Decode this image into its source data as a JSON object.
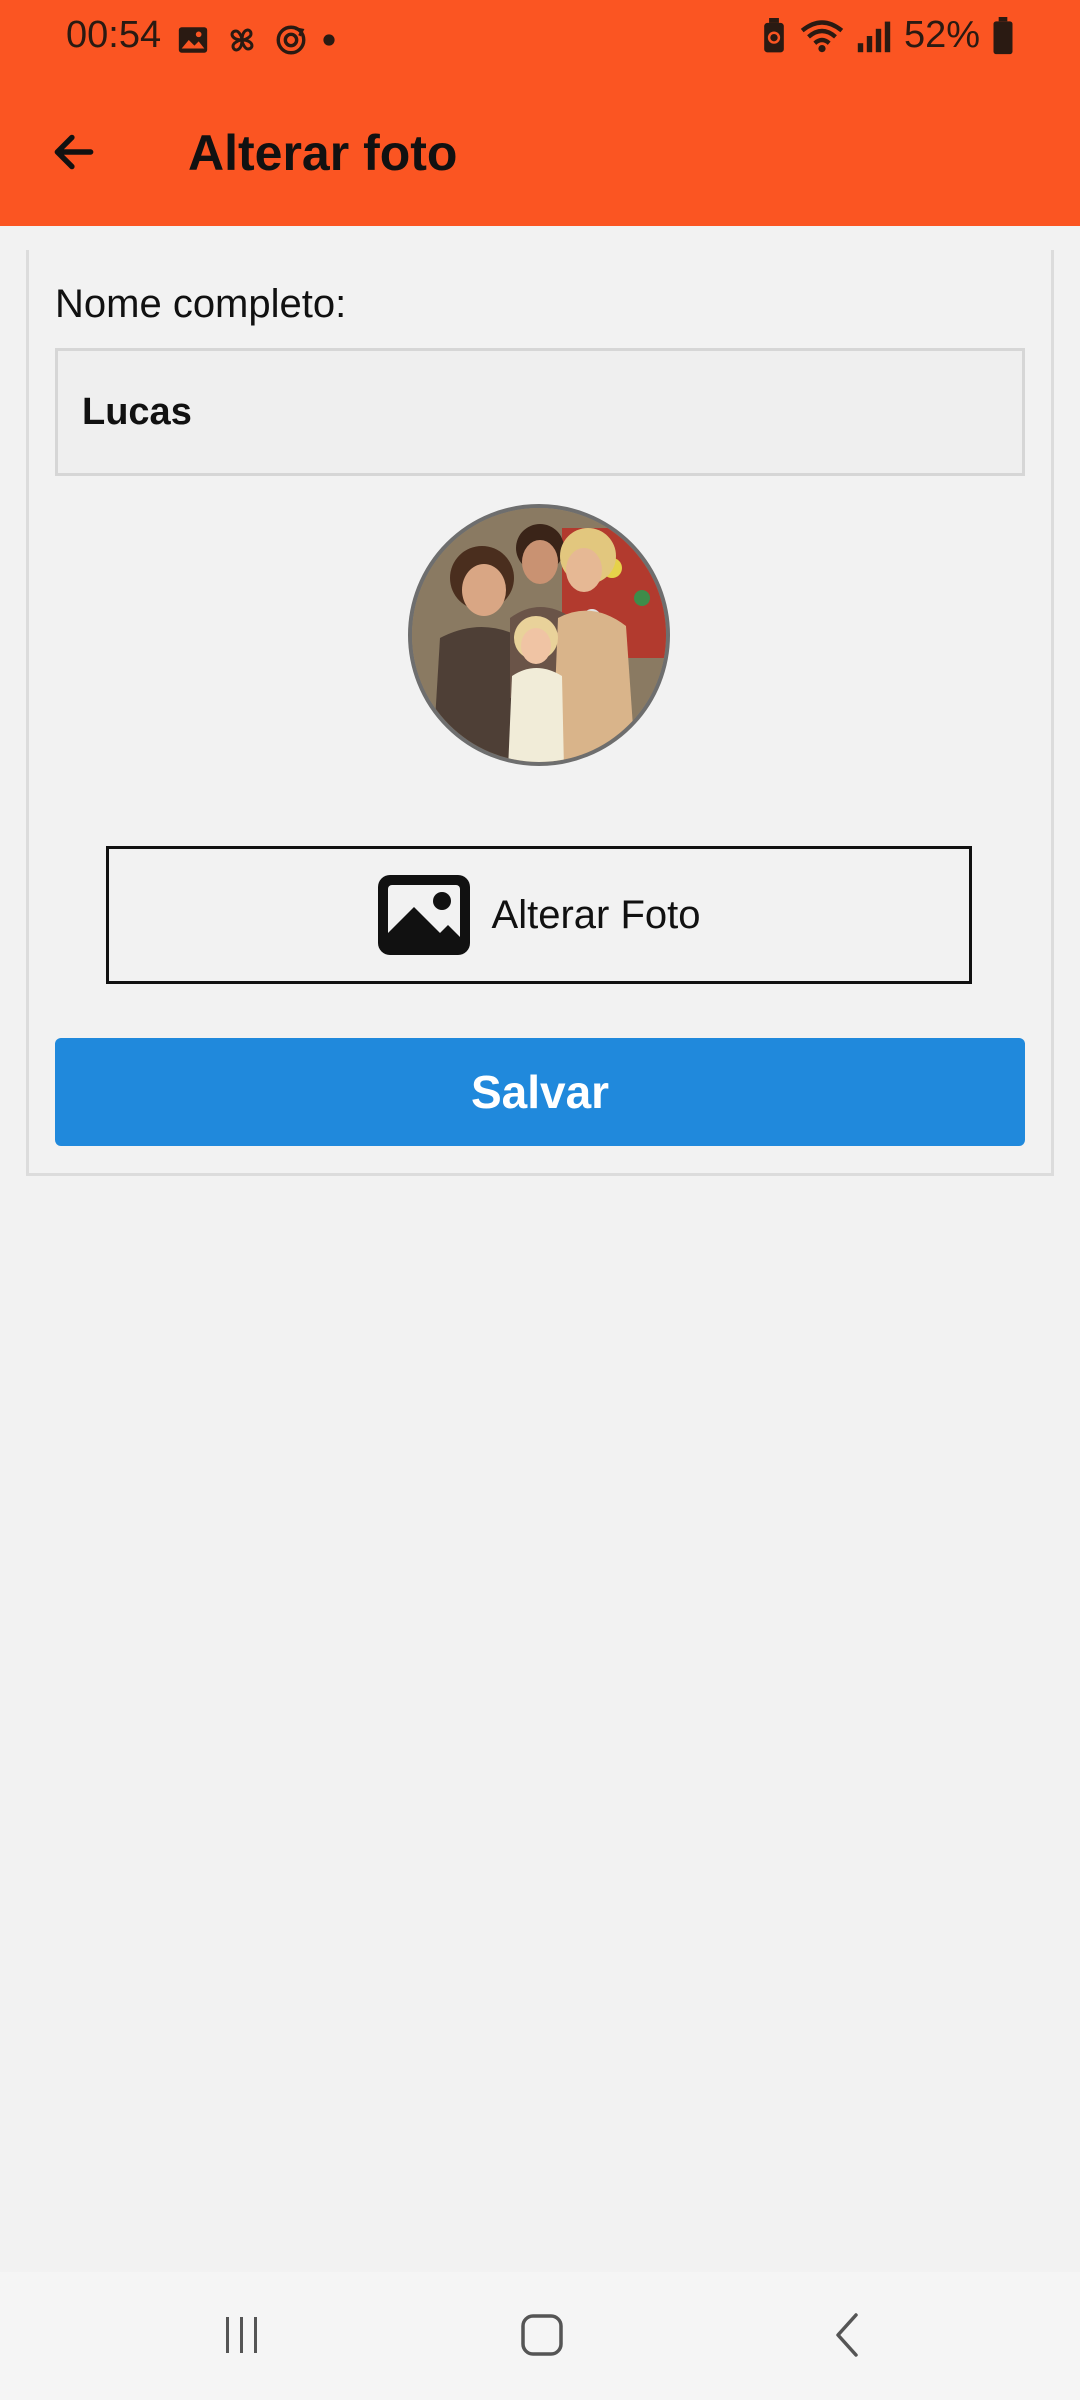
{
  "status_bar": {
    "time": "00:54",
    "left_icons": [
      "image-icon",
      "pinwheel-icon",
      "sync-icon",
      "dot-icon"
    ],
    "right_icons": [
      "battery-saver-icon",
      "wifi-icon",
      "signal-icon",
      "battery-icon"
    ],
    "battery_percent": "52%"
  },
  "toolbar": {
    "back_icon": "arrow-left-icon",
    "title": "Alterar foto"
  },
  "form": {
    "name_label": "Nome completo:",
    "name_value": "Lucas",
    "avatar_alt": "Foto de perfil",
    "change_photo_label": "Alterar Foto",
    "change_photo_icon": "image-icon",
    "save_label": "Salvar"
  },
  "nav_bar": {
    "buttons": [
      "recent-apps-icon",
      "home-icon",
      "back-icon"
    ]
  },
  "colors": {
    "app_bar": "#fb5522",
    "save_button": "#2089dc",
    "background": "#f2f2f2"
  }
}
